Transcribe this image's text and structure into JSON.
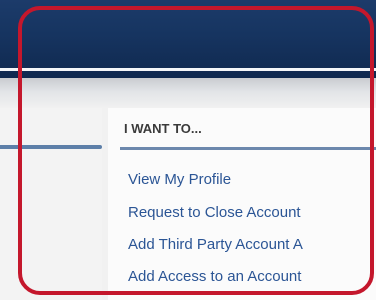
{
  "colors": {
    "banner": "#163460",
    "link": "#2b5595",
    "highlight": "#c4172c",
    "divider": "#6c88ad"
  },
  "panel": {
    "heading": "I WANT TO...",
    "links": [
      "View My Profile",
      "Request to Close Account",
      "Add Third Party Account A",
      "Add Access to an Account"
    ]
  }
}
